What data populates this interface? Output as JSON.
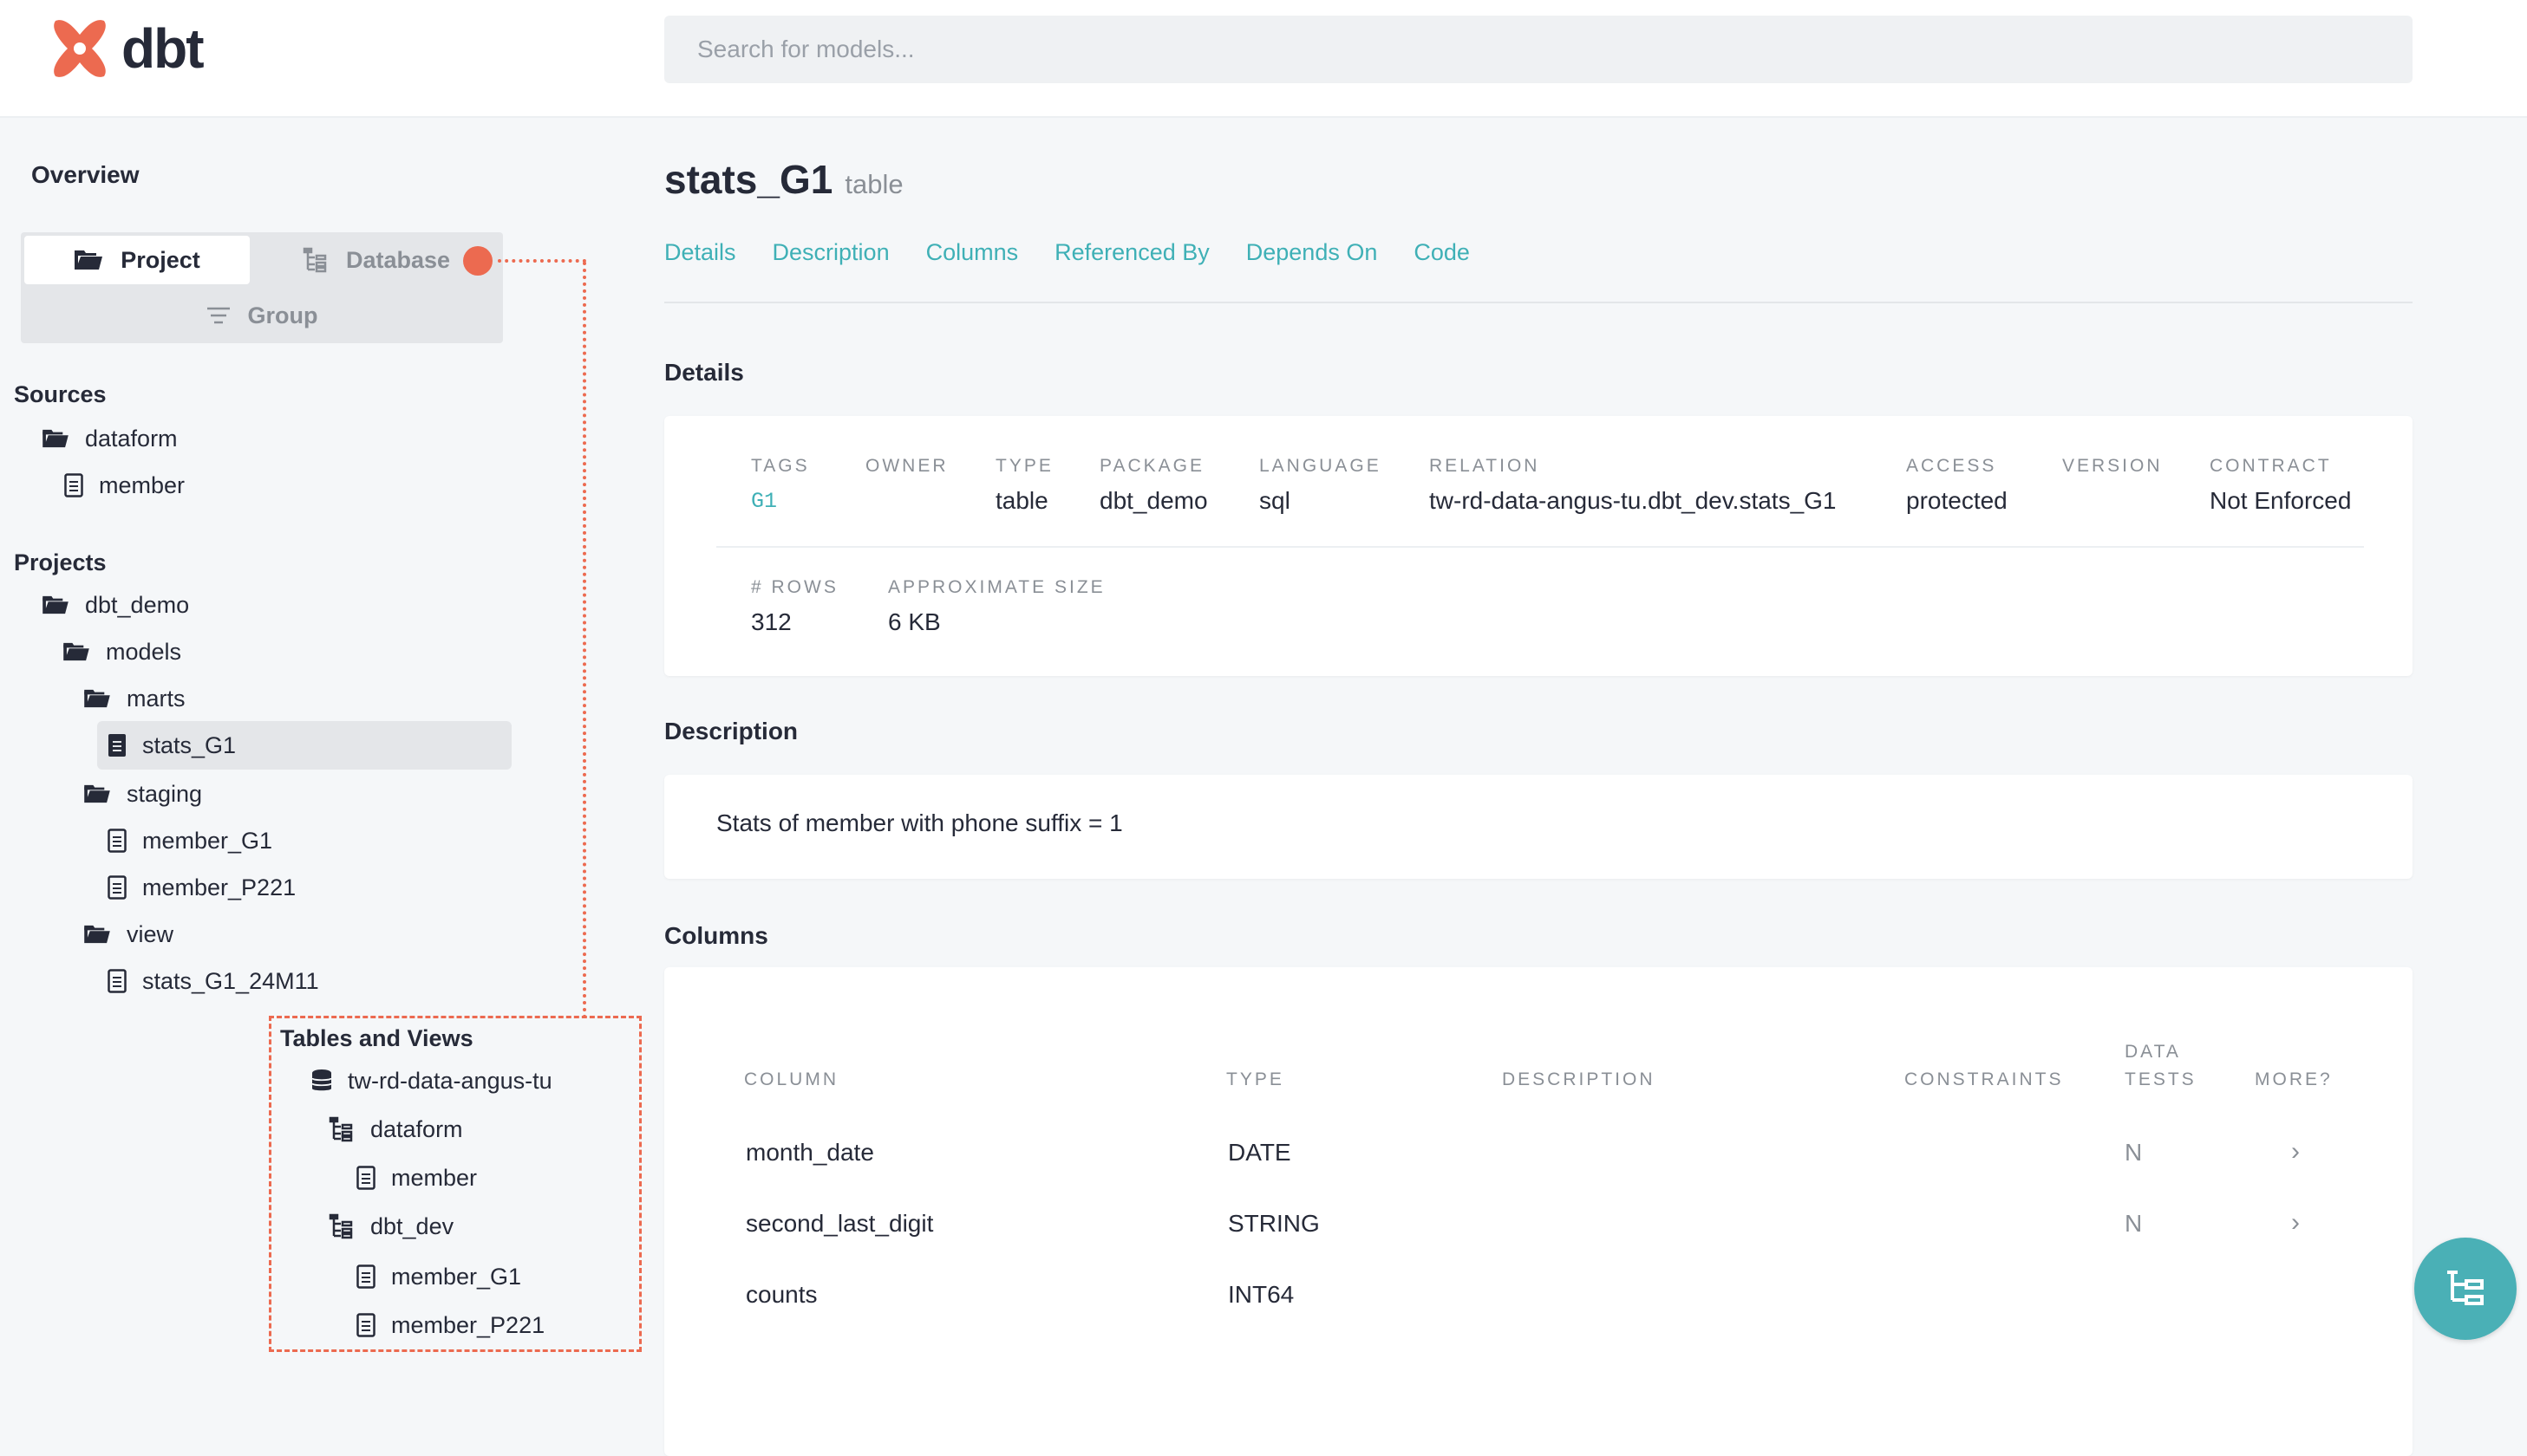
{
  "app": {
    "name": "dbt"
  },
  "search": {
    "placeholder": "Search for models..."
  },
  "sidebar": {
    "overview": "Overview",
    "toggle": {
      "project": "Project",
      "database": "Database",
      "group": "Group"
    },
    "sources": {
      "heading": "Sources",
      "items": [
        {
          "label": "dataform",
          "kind": "folder"
        },
        {
          "label": "member",
          "kind": "file"
        }
      ]
    },
    "projects": {
      "heading": "Projects",
      "items": [
        {
          "label": "dbt_demo",
          "kind": "folder"
        },
        {
          "label": "models",
          "kind": "folder"
        },
        {
          "label": "marts",
          "kind": "folder"
        },
        {
          "label": "stats_G1",
          "kind": "file",
          "selected": true
        },
        {
          "label": "staging",
          "kind": "folder"
        },
        {
          "label": "member_G1",
          "kind": "file"
        },
        {
          "label": "member_P221",
          "kind": "file"
        },
        {
          "label": "view",
          "kind": "folder"
        },
        {
          "label": "stats_G1_24M11",
          "kind": "file"
        }
      ]
    },
    "tables_and_views": {
      "heading": "Tables and Views",
      "items": [
        {
          "label": "tw-rd-data-angus-tu",
          "kind": "database"
        },
        {
          "label": "dataform",
          "kind": "schema"
        },
        {
          "label": "member",
          "kind": "file"
        },
        {
          "label": "dbt_dev",
          "kind": "schema"
        },
        {
          "label": "member_G1",
          "kind": "file"
        },
        {
          "label": "member_P221",
          "kind": "file"
        }
      ]
    }
  },
  "main": {
    "title": "stats_G1",
    "subtitle": "table",
    "tabs": [
      "Details",
      "Description",
      "Columns",
      "Referenced By",
      "Depends On",
      "Code"
    ],
    "details": {
      "heading": "Details",
      "fields": [
        {
          "label": "TAGS",
          "value": "G1"
        },
        {
          "label": "OWNER",
          "value": ""
        },
        {
          "label": "TYPE",
          "value": "table"
        },
        {
          "label": "PACKAGE",
          "value": "dbt_demo"
        },
        {
          "label": "LANGUAGE",
          "value": "sql"
        },
        {
          "label": "RELATION",
          "value": "tw-rd-data-angus-tu.dbt_dev.stats_G1"
        },
        {
          "label": "ACCESS",
          "value": "protected"
        },
        {
          "label": "VERSION",
          "value": ""
        },
        {
          "label": "CONTRACT",
          "value": "Not Enforced"
        }
      ],
      "fields2": [
        {
          "label": "# ROWS",
          "value": "312"
        },
        {
          "label": "APPROXIMATE SIZE",
          "value": "6 KB"
        }
      ]
    },
    "description": {
      "heading": "Description",
      "text": "Stats of member with phone suffix = 1"
    },
    "columns": {
      "heading": "Columns",
      "headers": {
        "column": "COLUMN",
        "type": "TYPE",
        "description": "DESCRIPTION",
        "constraints": "CONSTRAINTS",
        "data_tests_1": "DATA",
        "data_tests_2": "TESTS",
        "more": "MORE?"
      },
      "rows": [
        {
          "column": "month_date",
          "type": "DATE",
          "description": "",
          "constraints": "",
          "tests": "N",
          "more": "›"
        },
        {
          "column": "second_last_digit",
          "type": "STRING",
          "description": "",
          "constraints": "",
          "tests": "N",
          "more": "›"
        },
        {
          "column": "counts",
          "type": "INT64",
          "description": "",
          "constraints": "",
          "tests": "",
          "more": ""
        }
      ]
    }
  },
  "icons": {
    "logo": "dbt-logo-icon",
    "folder": "folder-icon",
    "file": "file-icon",
    "database": "database-icon",
    "schema": "schema-tree-icon",
    "group": "filter-lines-icon",
    "lineage": "lineage-icon"
  },
  "colors": {
    "accent": "#3fb0b6",
    "brand": "#ec6a50",
    "fab": "#4ab0b6"
  }
}
